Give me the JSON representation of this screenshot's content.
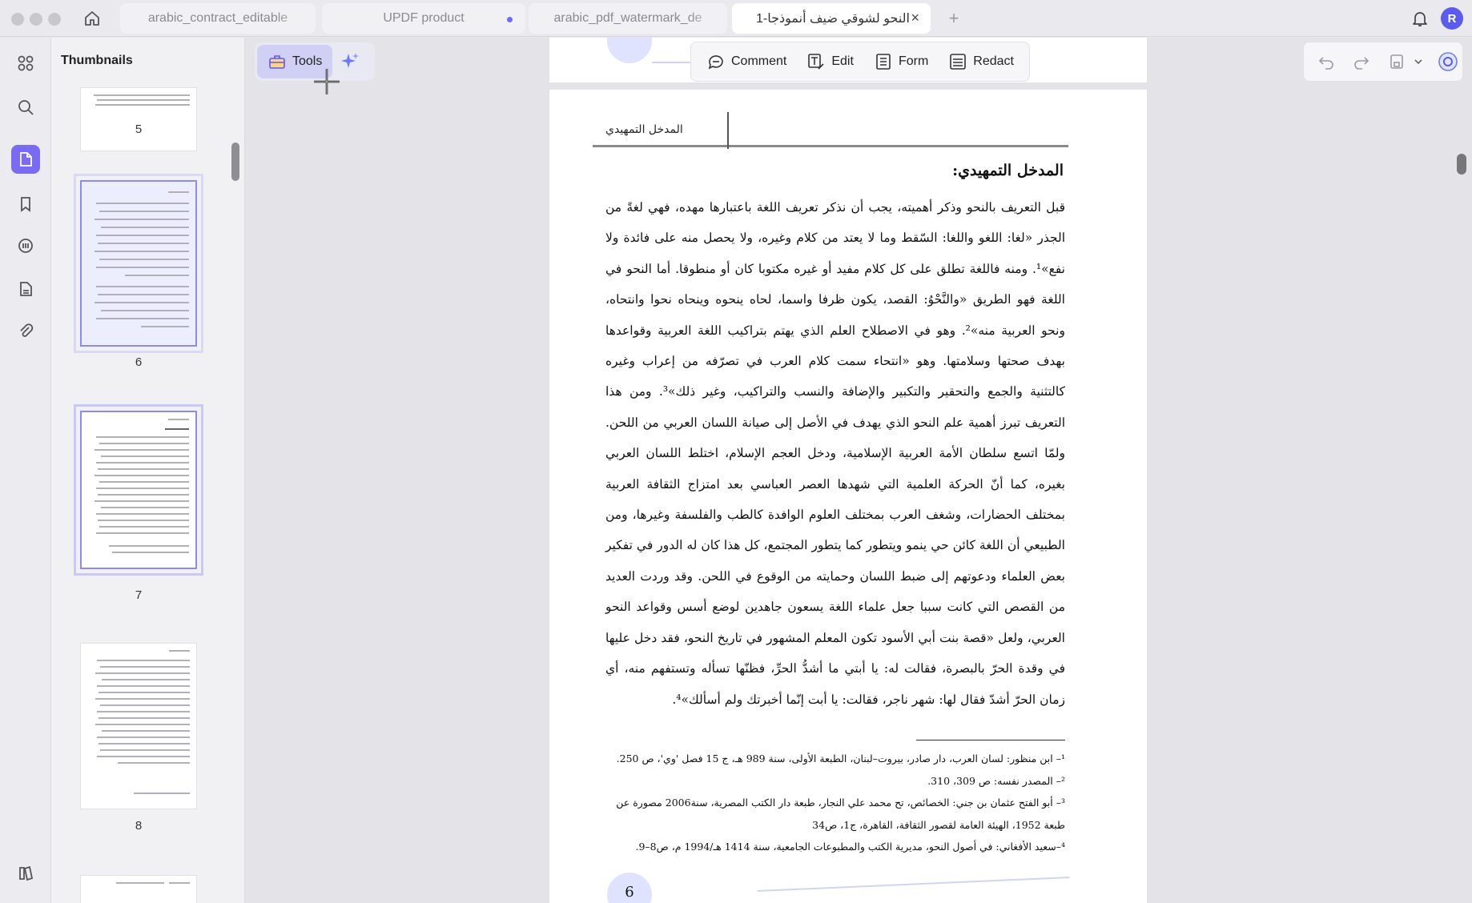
{
  "tabs": [
    {
      "label": "arabic_contract_editable",
      "state": "inactive",
      "modified": false
    },
    {
      "label": "UPDF product",
      "state": "inactive",
      "modified": true
    },
    {
      "label": "arabic_pdf_watermark_de",
      "state": "inactive",
      "modified": false
    },
    {
      "label": "النحو لشوقي ضيف أنموذجا-1",
      "state": "active",
      "modified": false
    }
  ],
  "user": {
    "avatar_letter": "R"
  },
  "sidebar": {
    "items": [
      {
        "name": "apps-icon"
      },
      {
        "name": "search-icon"
      },
      {
        "name": "pages-icon",
        "active": true
      },
      {
        "name": "bookmark-icon"
      },
      {
        "name": "comments-icon"
      },
      {
        "name": "document-icon"
      },
      {
        "name": "attachment-icon"
      },
      {
        "name": "layers-icon"
      }
    ]
  },
  "thumbnails": {
    "title": "Thumbnails",
    "pages": [
      {
        "number": "5"
      },
      {
        "number": "6"
      },
      {
        "number": "7"
      },
      {
        "number": "8"
      }
    ]
  },
  "toolbar": {
    "tools_label": "Tools",
    "comment_label": "Comment",
    "edit_label": "Edit",
    "form_label": "Form",
    "redact_label": "Redact"
  },
  "document": {
    "page_header": "المدخل التمهيدي",
    "heading": "المدخل التمهيدي:",
    "paragraph": "قبل التعريف بالنحو وذكر أهميته، يجب أن نذكر تعريف اللغة باعتبارها مهده، فهي لغةً من الجذر «لغا: اللغو واللغا: السّقط وما لا يعتد من كلام وغيره، ولا يحصل منه على فائدة ولا نفع»¹. ومنه فاللغة تطلق على كل كلام مفيد أو غيره مكتوبا كان أو منطوقا. أما النحو في اللغة فهو الطريق «والنَّحْوُ: القصد، يكون ظرفا واسما، لحاه ينحوه وينحاه نحوا وانتحاه، ونحو العربية منه»². وهو في الاصطلاح العلم الذي يهتم بتراكيب اللغة العربية وقواعدها بهدف صحتها وسلامتها. وهو «انتحاء سمت كلام العرب في تصرّفه من إعراب وغيره كالتثنية والجمع والتحقير والتكبير والإضافة والنسب والتراكيب، وغير ذلك»³. ومن هذا التعريف تبرز أهمية علم النحو الذي يهدف في الأصل إلى صيانة اللسان العربي من اللحن. ولمّا اتسع سلطان الأمة العربية الإسلامية، ودخل العجم الإسلام، اختلط اللسان العربي بغيره، كما أنّ الحركة العلمية التي شهدها العصر العباسي بعد امتزاج الثقافة العربية بمختلف الحضارات، وشغف العرب بمختلف العلوم الوافدة كالطب والفلسفة وغيرها، ومن الطبيعي أن اللغة كائن حي ينمو ويتطور كما يتطور المجتمع، كل هذا كان له الدور في تفكير بعض العلماء ودعوتهم إلى ضبط اللسان وحمايته من الوقوع في اللحن. وقد وردت العديد من القصص التي كانت سببا جعل علماء اللغة يسعون جاهدين لوضع أسس وقواعد النحو العربي، ولعل «قصة بنت أبي الأسود تكون المعلم المشهور في تاريخ النحو، فقد دخل عليها في وقدة الحرّ بالبصرة، فقالت له: يا أبتي ما أشدُّ الحرِّ، فظنّها تسأله وتستفهم منه، أي زمان الحرّ أشدّ فقال لها: شهر ناجر، فقالت: يا أبت إنّما أخبرتك ولم أسألك»⁴.",
    "footnotes": [
      "¹– ابن منظور: لسان العرب، دار صادر، بيروت–لبنان، الطبعة الأولى، سنة 989 هـ، ج 15 فصل 'وي'، ص 250.",
      "²– المصدر نفسه: ص 309، 310.",
      "³– أبو الفتح عثمان بن جني: الخصائص، تح محمد علي النجار، طبعة دار الكتب المصرية، سنة2006 مصورة عن طبعة 1952، الهيئة العامة لقصور الثقافة، القاهرة، ج1، ص34",
      "⁴–سعيد الأفغاني: في أصول النحو، مديرية الكتب والمطبوعات الجامعية، سنة 1414 هـ/1994 م، ص8–9."
    ],
    "page_number": "6"
  }
}
